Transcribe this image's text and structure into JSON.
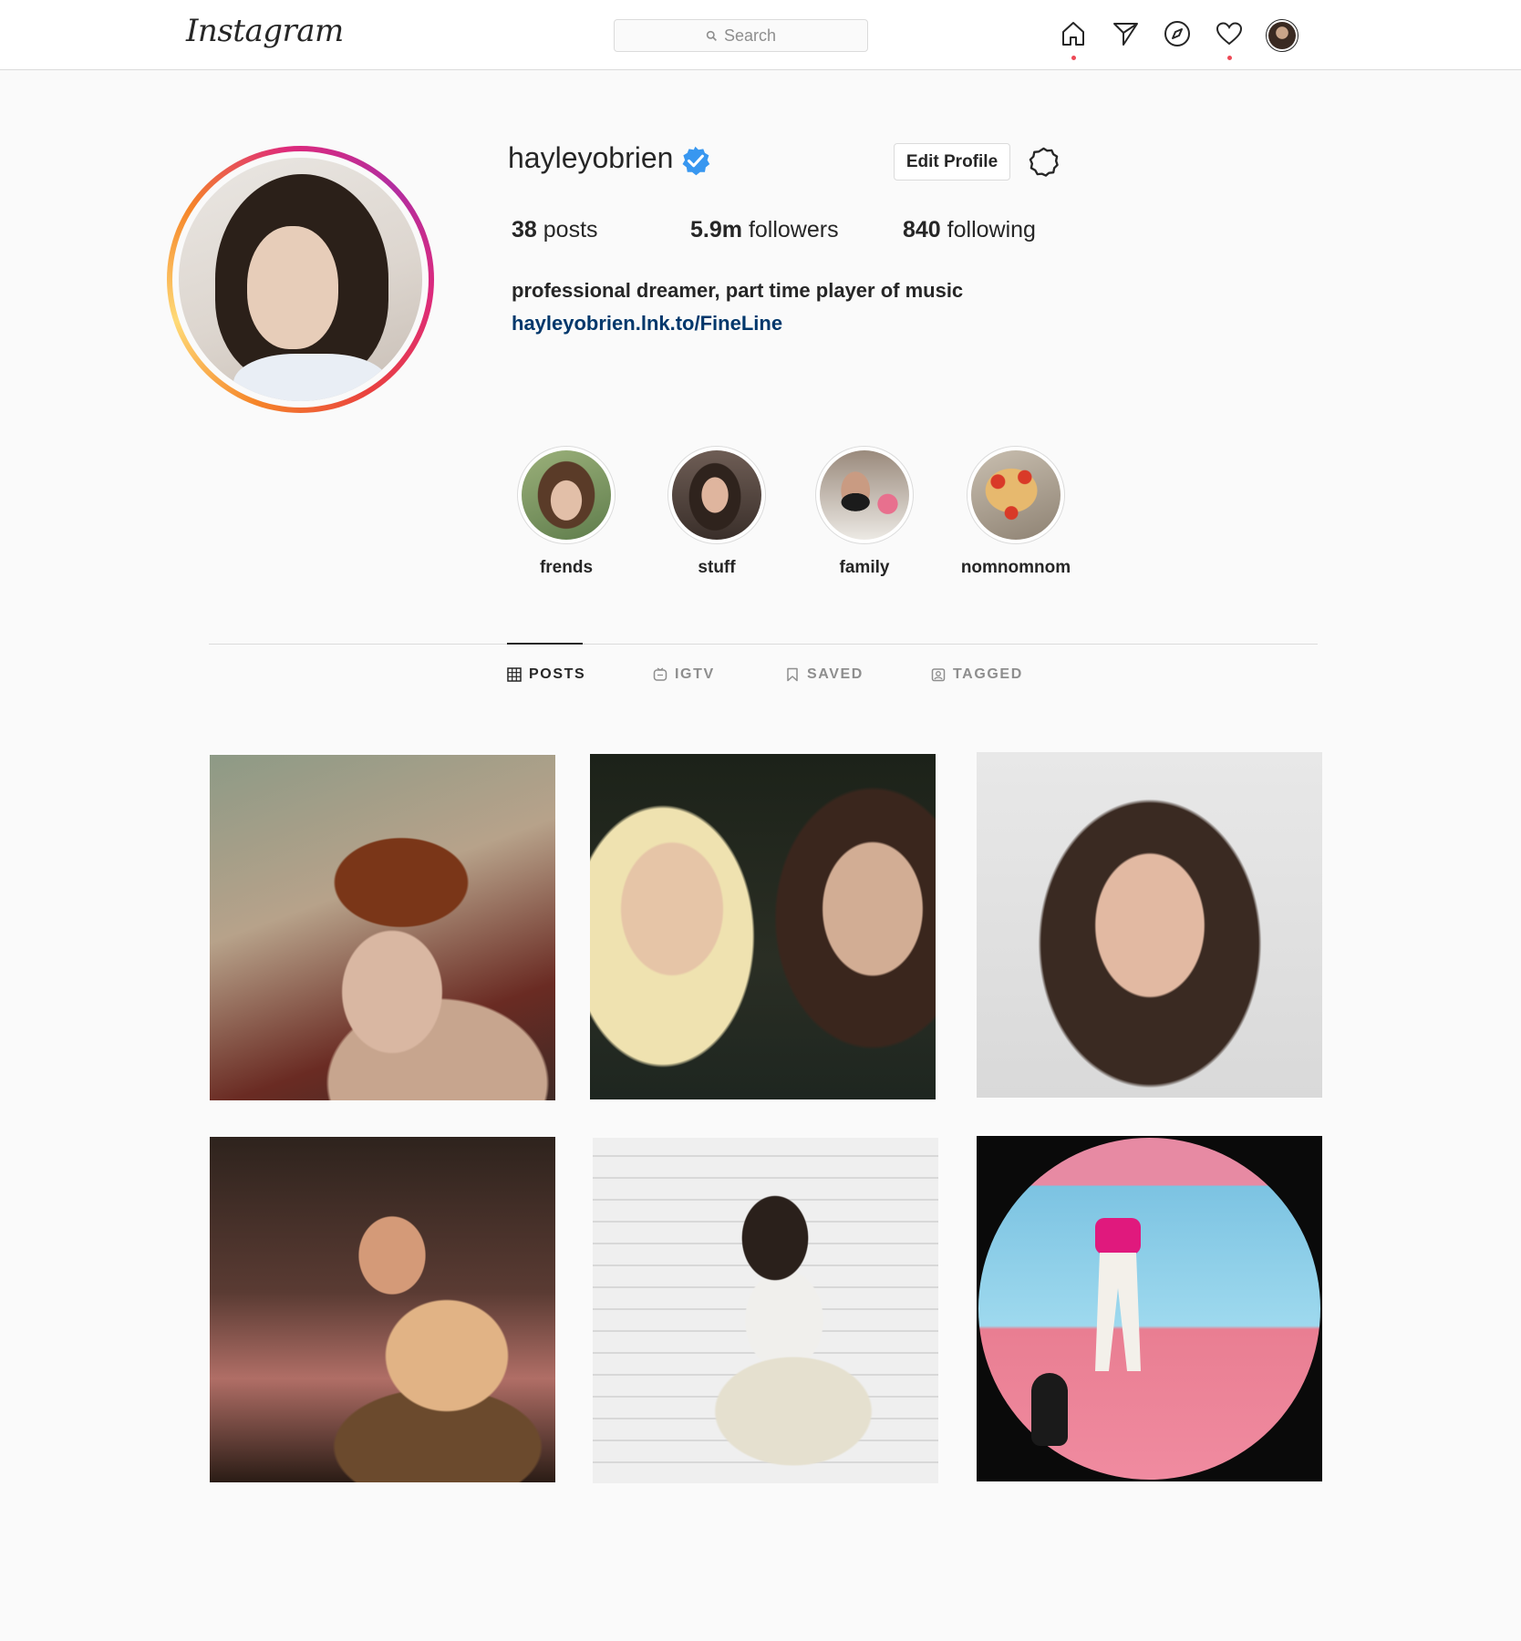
{
  "nav": {
    "logo": "Instagram",
    "search_placeholder": "Search",
    "icons": [
      "home-icon",
      "direct-icon",
      "explore-icon",
      "activity-icon",
      "profile-avatar"
    ]
  },
  "profile": {
    "username": "hayleyobrien",
    "verified": true,
    "edit_label": "Edit Profile",
    "stats": {
      "posts_count": "38",
      "posts_label": "posts",
      "followers_count": "5.9m",
      "followers_label": "followers",
      "following_count": "840",
      "following_label": "following"
    },
    "bio": "professional dreamer, part time player of music",
    "link": "hayleyobrien.lnk.to/FineLine"
  },
  "highlights": [
    {
      "label": "frends"
    },
    {
      "label": "stuff"
    },
    {
      "label": "family"
    },
    {
      "label": "nomnomnom"
    }
  ],
  "tabs": [
    {
      "label": "POSTS",
      "active": true
    },
    {
      "label": "IGTV",
      "active": false
    },
    {
      "label": "SAVED",
      "active": false
    },
    {
      "label": "TAGGED",
      "active": false
    }
  ],
  "colors": {
    "accent_link": "#00376b",
    "verified_blue": "#3897f0",
    "notification_dot": "#ed4956",
    "border": "#dbdbdb",
    "background": "#fafafa"
  }
}
